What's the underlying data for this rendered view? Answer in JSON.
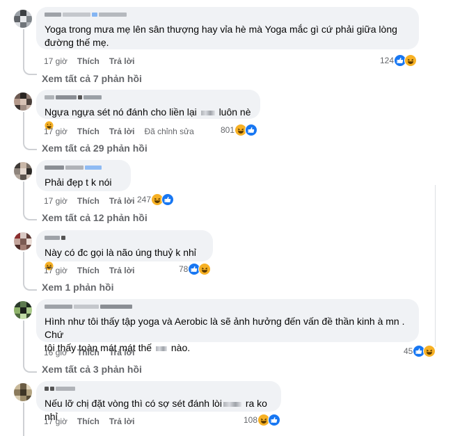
{
  "comments": [
    {
      "text": "Yoga trong mưa mẹ lên sân thượng hay vỉa hè mà Yoga mắc gì cứ phải giữa lòng đường thế mẹ.",
      "time": "17 giờ",
      "like_label": "Thích",
      "reply_label": "Trả lời",
      "edited": "",
      "reactions": "124",
      "view_replies": "Xem tất cả 7 phản hồi"
    },
    {
      "text_before": "Ngựa ngựa sét nó đánh cho liền lại",
      "text_after": "luôn nè",
      "time": "17 giờ",
      "like_label": "Thích",
      "reply_label": "Trả lời",
      "edited": "Đã chỉnh sửa",
      "reactions": "801",
      "view_replies": "Xem tất cả 29 phản hồi"
    },
    {
      "text": "Phải đẹp t k nói",
      "time": "17 giờ",
      "like_label": "Thích",
      "reply_label": "Trả lời",
      "reactions": "247",
      "view_replies": "Xem tất cả 12 phản hồi"
    },
    {
      "text": "Này có đc gọi là não úng thuỷ k nhỉ",
      "time": "17 giờ",
      "like_label": "Thích",
      "reply_label": "Trả lời",
      "reactions": "78",
      "view_replies": "Xem 1 phản hồi"
    },
    {
      "text_line1": "Hình như tôi thấy tập yoga và Aerobic là sẽ ảnh hưởng đến vấn đề thần kinh à mn . Chứ",
      "text_line2_before": "tôi thấy toàn mát mát thế",
      "text_line2_after": "nào.",
      "time": "16 giờ",
      "like_label": "Thích",
      "reply_label": "Trả lời",
      "reactions": "45",
      "view_replies": "Xem tất cả 3 phản hồi"
    },
    {
      "text_before": "Nếu lỡ chị đặt vòng thì có sợ sét đánh lòi",
      "text_after": "ra ko nhỉ",
      "time": "17 giờ",
      "like_label": "Thích",
      "reply_label": "Trả lời",
      "reactions": "108"
    }
  ],
  "colors": {
    "bubble": "#f0f2f5",
    "meta": "#65676b",
    "like": "#1877f2",
    "haha": "#f7b125"
  },
  "icons": [
    "like-reaction-icon",
    "haha-reaction-icon",
    "grinning-emoji-icon"
  ]
}
